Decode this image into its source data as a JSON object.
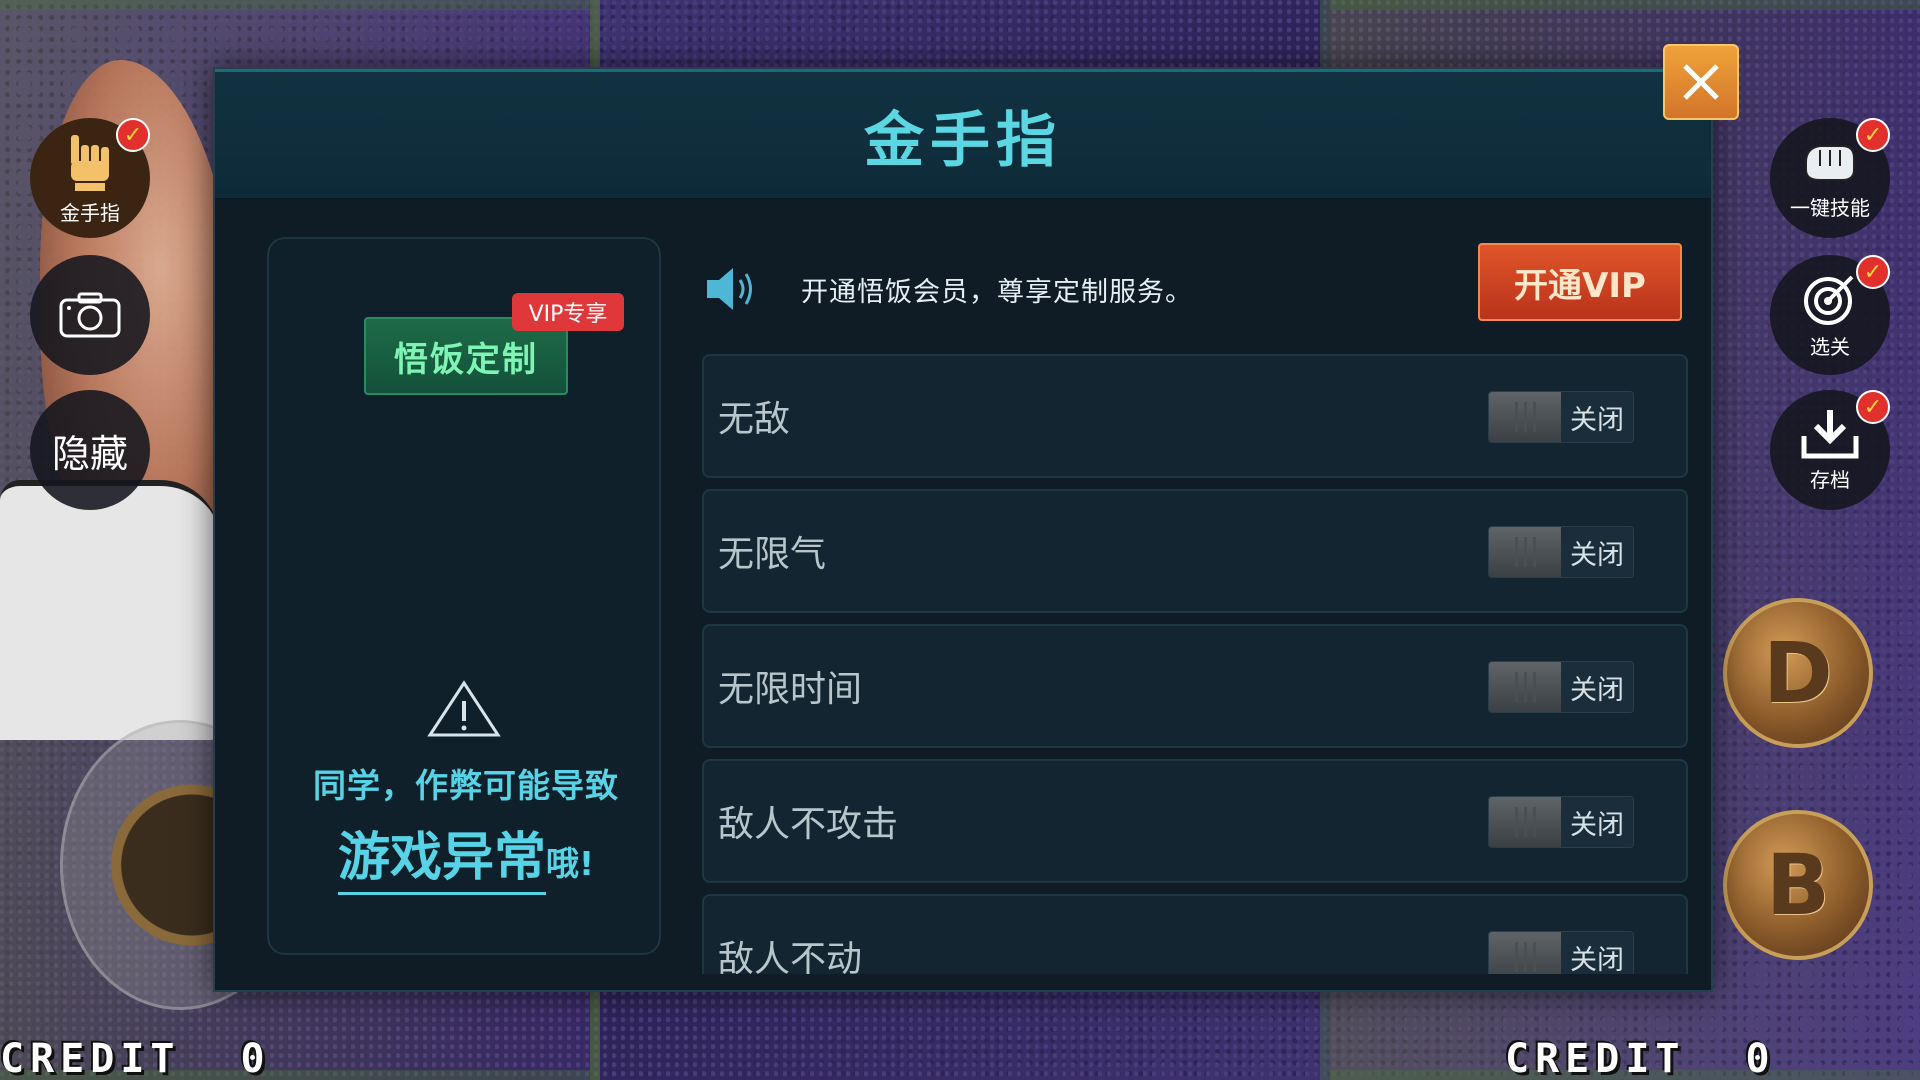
{
  "background": {
    "credit_left_label": "CREDIT",
    "credit_left_value": "0",
    "credit_right_label": "CREDIT",
    "credit_right_value": "0"
  },
  "side_left": {
    "golden_finger_label": "金手指",
    "hide_label": "隐藏"
  },
  "side_right": {
    "one_click_label": "一键技能",
    "select_stage_label": "选关",
    "save_label": "存档"
  },
  "badge_check": "✓",
  "keys": {
    "d": "D",
    "b": "B"
  },
  "modal": {
    "title": "金手指",
    "custom_button": "悟饭定制",
    "vip_badge": "VIP专享",
    "warning_line1": "同学，作弊可能导致",
    "warning_emph": "游戏异常",
    "warning_tail": "哦!",
    "notice": "开通悟饭会员，尊享定制服务。",
    "vip_button": "开通VIP",
    "cheats": [
      {
        "label": "无敌",
        "state": "关闭"
      },
      {
        "label": "无限气",
        "state": "关闭"
      },
      {
        "label": "无限时间",
        "state": "关闭"
      },
      {
        "label": "敌人不攻击",
        "state": "关闭"
      },
      {
        "label": "敌人不动",
        "state": "关闭"
      }
    ]
  },
  "colors": {
    "title_cyan": "#5ad7e2",
    "vip_orange": "#d9492a",
    "custom_green": "#1e6b47",
    "badge_red": "#e0373a"
  }
}
